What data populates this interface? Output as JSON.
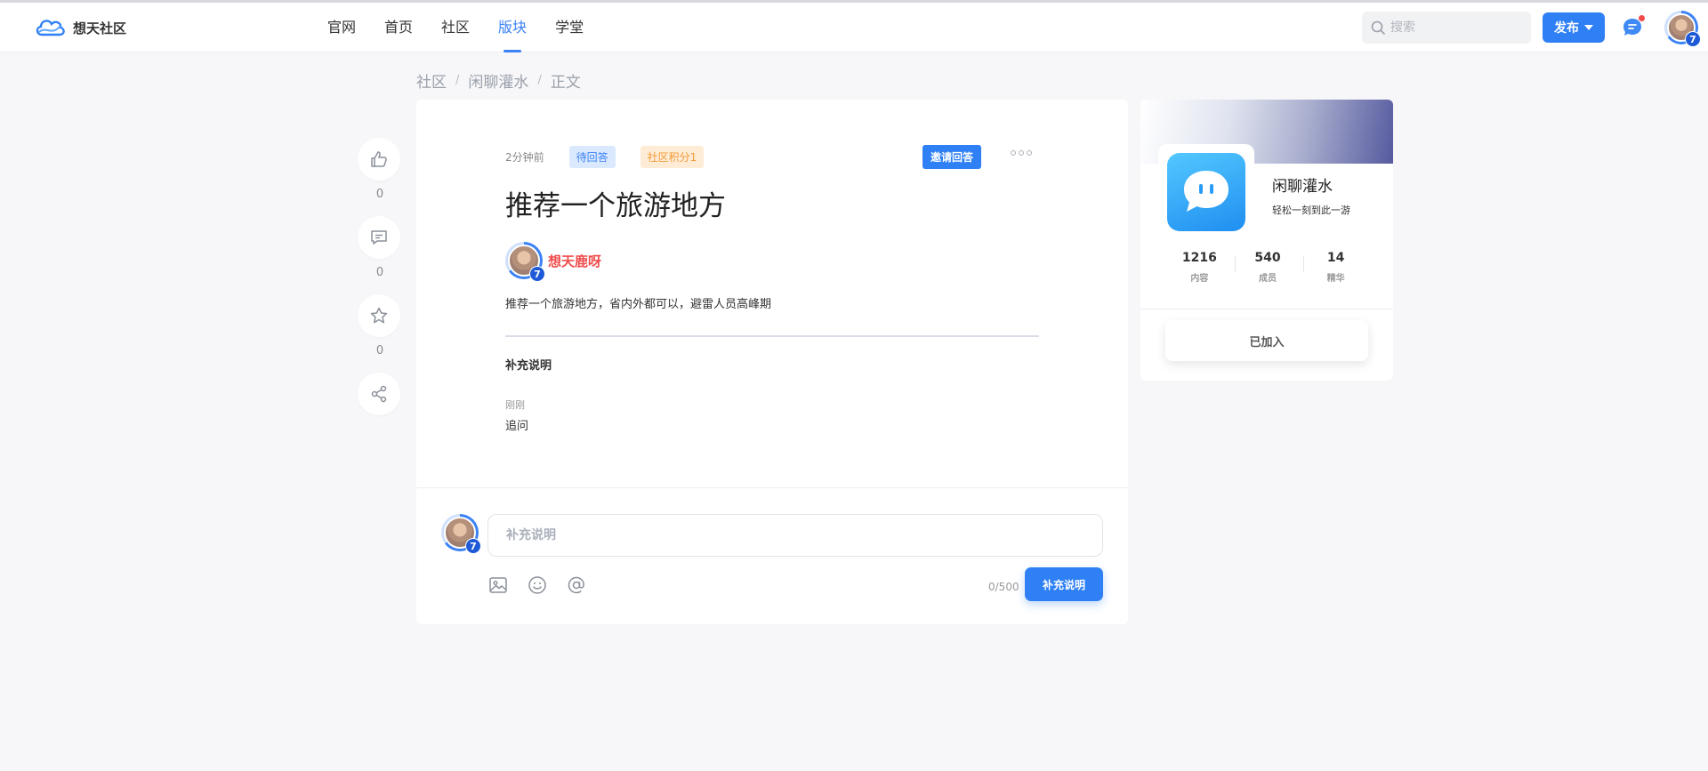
{
  "header": {
    "logo_text": "想天社区",
    "nav": [
      {
        "label": "官网"
      },
      {
        "label": "首页"
      },
      {
        "label": "社区"
      },
      {
        "label": "版块",
        "active": true
      },
      {
        "label": "学堂"
      }
    ],
    "search_placeholder": "搜索",
    "publish_label": "发布",
    "user_level": "7"
  },
  "breadcrumb": [
    "社区",
    "闲聊灌水",
    "正文"
  ],
  "breadcrumb_sep": "/",
  "actions": [
    {
      "icon": "thumbs-up-icon",
      "count": "0"
    },
    {
      "icon": "comment-icon",
      "count": "0"
    },
    {
      "icon": "star-icon",
      "count": "0"
    },
    {
      "icon": "share-icon",
      "count": ""
    }
  ],
  "post": {
    "time": "2分钟前",
    "status_tag": "待回答",
    "points_tag": "社区积分1",
    "invite_label": "邀请回答",
    "title": "推荐一个旅游地方",
    "author": {
      "name": "想天鹿呀",
      "level": "7"
    },
    "body": "推荐一个旅游地方，省内外都可以，避雷人员高峰期",
    "supplement": {
      "heading": "补充说明",
      "time": "刚刚",
      "text": "追问"
    }
  },
  "comment_box": {
    "user_level": "7",
    "placeholder": "补充说明",
    "counter": "0/500",
    "submit_label": "补充说明"
  },
  "board": {
    "name": "闲聊灌水",
    "description": "轻松一刻到此一游",
    "stats": [
      {
        "value": "1216",
        "label": "内容"
      },
      {
        "value": "540",
        "label": "成员"
      },
      {
        "value": "14",
        "label": "精华"
      }
    ],
    "joined_label": "已加入"
  },
  "colors": {
    "accent": "#2f80f5",
    "author_name": "#f04b4b",
    "tag_wait_bg": "#dbe9ff",
    "tag_points_bg": "#ffecd6"
  }
}
